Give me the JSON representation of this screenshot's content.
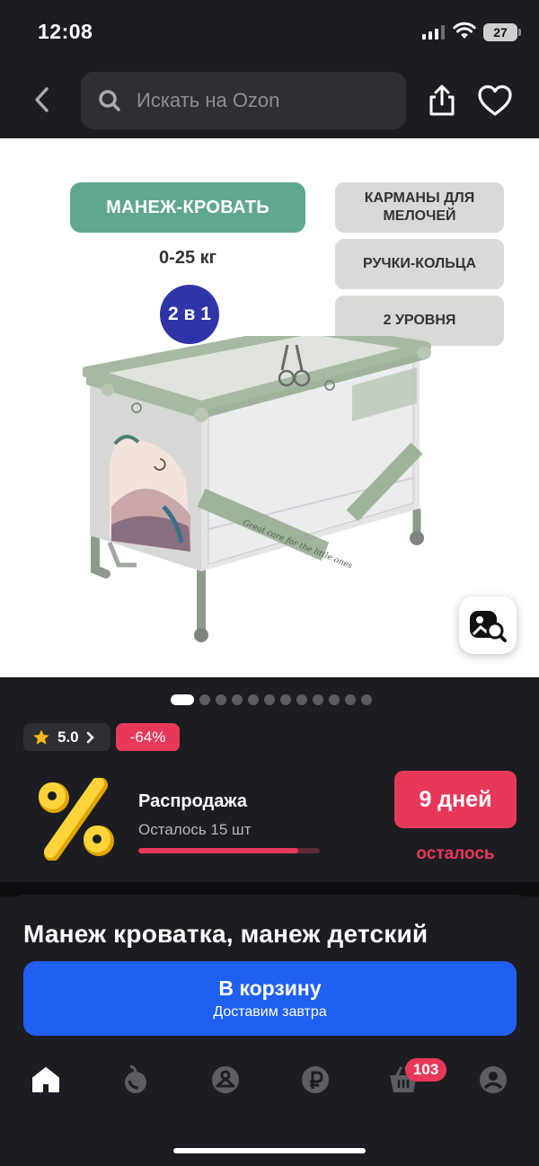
{
  "status_bar": {
    "time": "12:08",
    "battery": "27"
  },
  "header": {
    "search_placeholder": "Искать на Ozon"
  },
  "gallery": {
    "badge_main": "МАНЕЖ-КРОВАТЬ",
    "weight": "0-25 кг",
    "two_in_one": "2 в 1",
    "features": [
      "КАРМАНЫ ДЛЯ МЕЛОЧЕЙ",
      "РУЧКИ-КОЛЬЦА",
      "2 УРОВНЯ"
    ],
    "crib_print_text": "Great care for the little ones",
    "dots_count": 12,
    "active_dot": 0
  },
  "rating": {
    "value": "5.0"
  },
  "discount": "-64%",
  "sale": {
    "title": "Распродажа",
    "remaining": "Осталось 15 шт",
    "progress_fraction": 0.88,
    "days_label": "9 дней",
    "days_suffix": "осталось"
  },
  "product": {
    "title": "Манеж кроватка, манеж детский",
    "cart_label": "В корзину",
    "cart_sub": "Доставим завтра"
  },
  "tabbar": {
    "items": [
      "home-icon",
      "fresh-icon",
      "catalog-icon",
      "ruble-icon",
      "cart-icon",
      "profile-icon"
    ],
    "cart_badge": "103"
  },
  "colors": {
    "background": "#1c1d22",
    "accent_red": "#e8385a",
    "accent_blue": "#1f5ff2",
    "badge_green": "#5fa88f",
    "badge_navy": "#2f34a8"
  }
}
